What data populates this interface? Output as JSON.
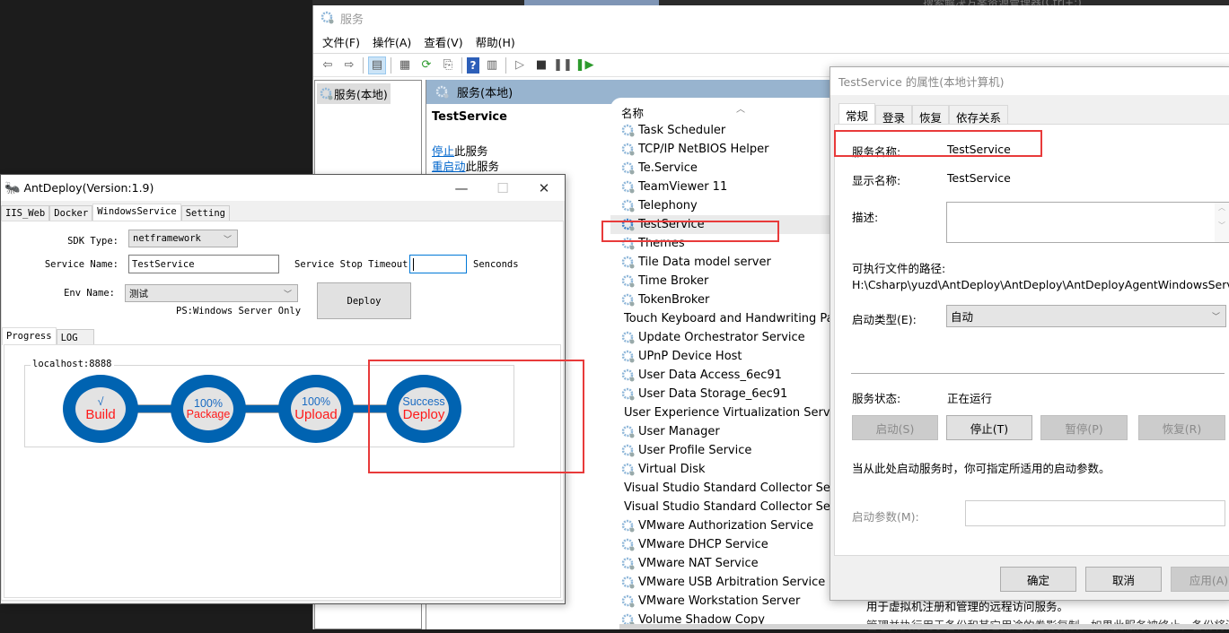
{
  "background": {
    "search_hint": "搜索解决方案资源管理器(Ctrl+;)"
  },
  "services_window": {
    "title": "服务",
    "menu": [
      "文件(F)",
      "操作(A)",
      "查看(V)",
      "帮助(H)"
    ],
    "toolbar_icons": [
      "back-icon",
      "forward-icon",
      "show-hide-tree-icon",
      "properties-icon",
      "refresh-icon",
      "export-list-icon",
      "help-icon",
      "show-action-pane-icon",
      "start-service-icon",
      "stop-service-icon",
      "pause-service-icon",
      "restart-service-icon"
    ],
    "tree_item": "服务(本地)",
    "pane_header": "服务(本地)",
    "selected_service": {
      "name": "TestService",
      "stop_link": "停止",
      "stop_suffix": "此服务",
      "restart_link": "重启动",
      "restart_suffix": "此服务"
    },
    "column_name": "名称",
    "services": [
      "Task Scheduler",
      "TCP/IP NetBIOS Helper",
      "Te.Service",
      "TeamViewer 11",
      "Telephony",
      "TestService",
      "Themes",
      "Tile Data model server",
      "Time Broker",
      "TokenBroker",
      "Touch Keyboard and Handwriting Panel Service",
      "Update Orchestrator Service",
      "UPnP Device Host",
      "User Data Access_6ec91",
      "User Data Storage_6ec91",
      "User Experience Virtualization Service",
      "User Manager",
      "User Profile Service",
      "Virtual Disk",
      "Visual Studio Standard Collector Service",
      "Visual Studio Standard Collector Service",
      "VMware Authorization Service",
      "VMware DHCP Service",
      "VMware NAT Service",
      "VMware USB Arbitration Service",
      "VMware Workstation Server",
      "Volume Shadow Copy"
    ],
    "selected_index": 5,
    "desc_text_1": "用于虚拟机注册和管理的远程访问服务。",
    "desc_text_2": "管理并执行用于备份和其它用途的卷影复制。如果此服务被终止，备份将没有卷影复制"
  },
  "antdeploy": {
    "title": "AntDeploy(Version:1.9)",
    "tabs": [
      "IIS_Web",
      "Docker",
      "WindowsService",
      "Setting"
    ],
    "active_tab": "WindowsService",
    "sdk_type_label": "SDK Type:",
    "sdk_type_value": "netframework",
    "service_name_label": "Service Name:",
    "service_name_value": "TestService",
    "stop_timeout_label": "Service Stop Timeout:",
    "stop_timeout_value": "",
    "stop_timeout_unit": "Senconds",
    "env_name_label": "Env Name:",
    "env_name_value": "测试",
    "env_note": "PS:Windows Server Only",
    "deploy_button": "Deploy",
    "sub_tabs": [
      "Progress",
      "LOG"
    ],
    "active_sub_tab": "Progress",
    "server_group": "localhost:8888",
    "steps": [
      {
        "top": "√",
        "label": "Build"
      },
      {
        "top": "100%",
        "label": "Package"
      },
      {
        "top": "100%",
        "label": "Upload"
      },
      {
        "top": "Success",
        "label": "Deploy"
      }
    ],
    "colors": {
      "step_ring": "#0063b1",
      "step_label": "#ff1a1a",
      "step_status": "#1a6bc2"
    }
  },
  "properties_dialog": {
    "title": "TestService 的属性(本地计算机)",
    "tabs": [
      "常规",
      "登录",
      "恢复",
      "依存关系"
    ],
    "active_tab": "常规",
    "service_name_label": "服务名称:",
    "service_name_value": "TestService",
    "display_name_label": "显示名称:",
    "display_name_value": "TestService",
    "description_label": "描述:",
    "description_value": "",
    "exe_path_label": "可执行文件的路径:",
    "exe_path_value": "H:\\Csharp\\yuzd\\AntDeploy\\AntDeploy\\AntDeployAgentWindowsService\\",
    "startup_type_label": "启动类型(E):",
    "startup_type_value": "自动",
    "status_label": "服务状态:",
    "status_value": "正在运行",
    "start_button": "启动(S)",
    "stop_button": "停止(T)",
    "pause_button": "暂停(P)",
    "resume_button": "恢复(R)",
    "start_params_hint": "当从此处启动服务时，你可指定所适用的启动参数。",
    "start_params_label": "启动参数(M):",
    "start_params_value": "",
    "ok_button": "确定",
    "cancel_button": "取消",
    "apply_button": "应用(A)"
  },
  "annotation_color": "#e83a3a"
}
